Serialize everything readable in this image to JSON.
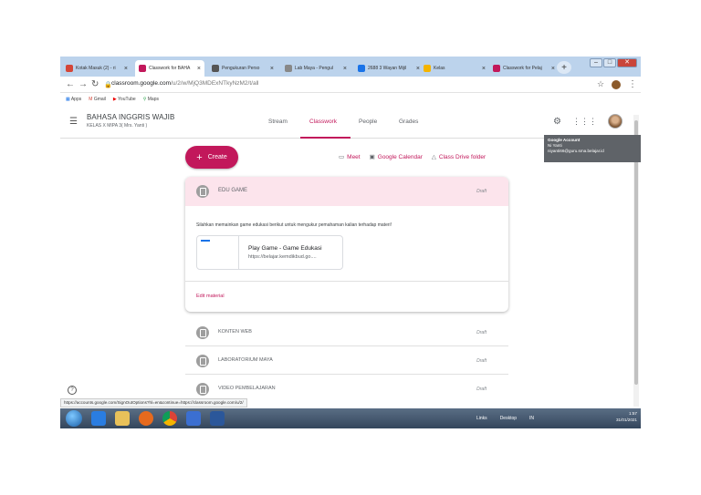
{
  "browser": {
    "tabs": [
      {
        "label": "Kotak Masuk (2) - ri",
        "icon": "gmail-icon",
        "color": "#d44638",
        "active": false
      },
      {
        "label": "Classwork for BAHA",
        "icon": "classroom-icon",
        "color": "#c2185b",
        "active": true
      },
      {
        "label": "Pengukuran Perso",
        "icon": "chrome-icon",
        "color": "#555555",
        "active": false
      },
      {
        "label": "Lab Maya - Pengul",
        "icon": "page-icon",
        "color": "#888888",
        "active": false
      },
      {
        "label": "2688 3 Wayan Mijil",
        "icon": "drive-icon",
        "color": "#1a73e8",
        "active": false
      },
      {
        "label": "Kelas",
        "icon": "classroom-icon",
        "color": "#f4b400",
        "active": false
      },
      {
        "label": "Classwork for Pelaj",
        "icon": "classroom-icon",
        "color": "#c2185b",
        "active": false
      }
    ],
    "new_tab": "+",
    "url_host": "classroom.google.com",
    "url_path": "/u/2/w/MjQ3MDExNTkyNzM2/t/all",
    "bookmarks": [
      "Apps",
      "Gmail",
      "YouTube",
      "Maps"
    ]
  },
  "classroom": {
    "course_title": "BAHASA INGGRIS WAJIB",
    "course_subtitle": "KELAS X MIPA 3( Mrs. Yanti )",
    "nav_tabs": [
      "Stream",
      "Classwork",
      "People",
      "Grades"
    ],
    "active_tab": "Classwork",
    "tooltip": {
      "title": "Google Account",
      "name": "Ni Yanti",
      "email": "niyanti66@guru.sma.belajar.id"
    },
    "create_label": "Create",
    "tools": [
      "Meet",
      "Google Calendar",
      "Class Drive folder"
    ],
    "expanded_topic": {
      "title": "EDU GAME",
      "status": "Draft",
      "description": "Silahkan memainkan game edukasi berikut untuk mengukur pemahaman kalian terhadap materi!",
      "attachment_title": "Play Game - Game Edukasi",
      "attachment_url": "https://belajar.kemdikbud.go....",
      "edit_label": "Edit material"
    },
    "topics": [
      {
        "title": "KONTEN WEB",
        "status": "Draft"
      },
      {
        "title": "LABORATORIUM MAYA",
        "status": "Draft"
      },
      {
        "title": "VIDEO PEMBELAJARAN",
        "status": "Draft"
      }
    ],
    "status_url": "https://accounts.google.com/SignOutOptions?hl=en&continue=https://classroom.google.com/u/2/"
  },
  "taskbar": {
    "links_label": "Links",
    "desktop_label": "Desktop",
    "lang": "IN",
    "time": "1:57",
    "date": "31/01/2021"
  }
}
